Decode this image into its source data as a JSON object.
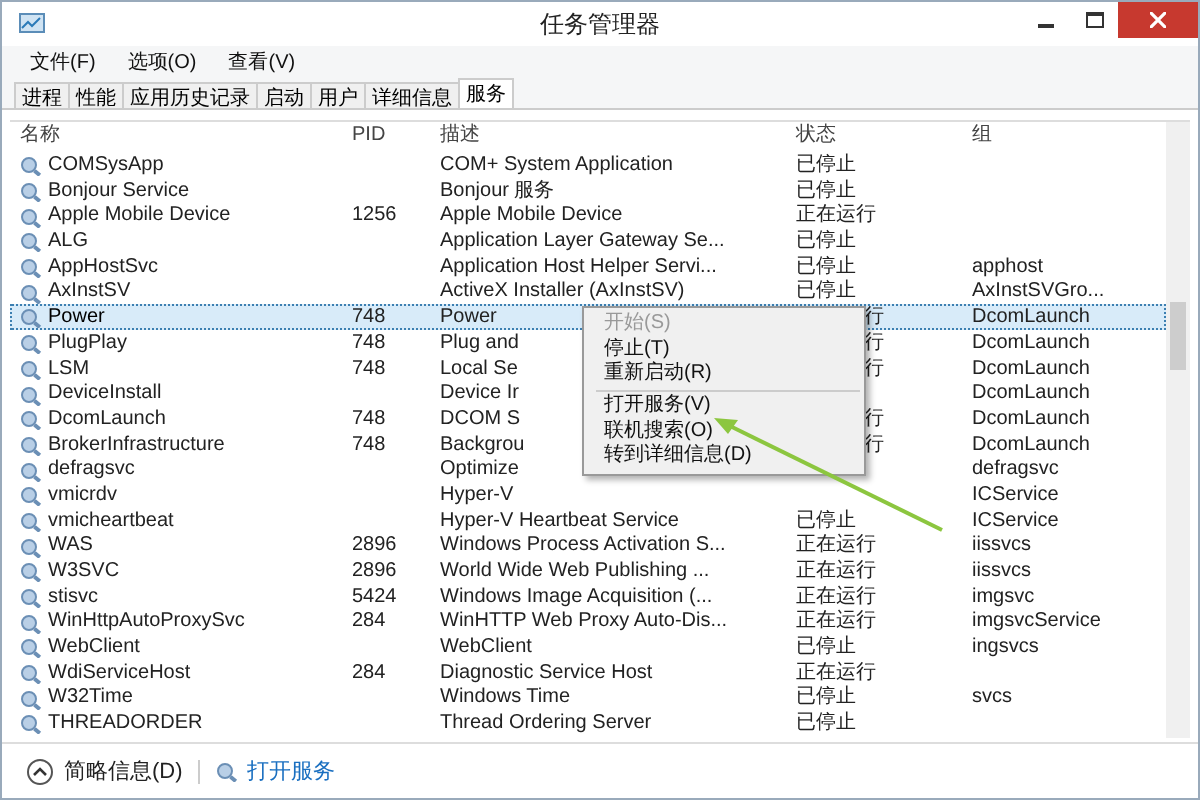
{
  "window": {
    "title": "任务管理器"
  },
  "menu_bar": [
    "文件(F)",
    "选项(O)",
    "查看(V)"
  ],
  "tabs": [
    {
      "label": "进程",
      "selected": false
    },
    {
      "label": "性能",
      "selected": false
    },
    {
      "label": "应用历史记录",
      "selected": false
    },
    {
      "label": "启动",
      "selected": false
    },
    {
      "label": "用户",
      "selected": false
    },
    {
      "label": "详细信息",
      "selected": false
    },
    {
      "label": "服务",
      "selected": true
    }
  ],
  "table": {
    "columns": [
      "名称",
      "PID",
      "描述",
      "状态",
      "组"
    ],
    "rows": [
      {
        "name": "COMSysApp",
        "description": "COM+ System Application",
        "status": "已停止",
        "selected": false
      },
      {
        "name": "Bonjour Service",
        "description": "Bonjour 服务",
        "status": "已停止",
        "selected": false
      },
      {
        "name": "Apple Mobile Device",
        "pid": "1256",
        "description": "Apple Mobile Device",
        "status": "正在运行",
        "selected": false
      },
      {
        "name": "ALG",
        "description": "Application Layer Gateway Se...",
        "status": "已停止",
        "selected": false
      },
      {
        "name": "AppHostSvc",
        "description": "Application Host Helper Servi...",
        "status": "已停止",
        "group": "apphost",
        "selected": false
      },
      {
        "name": "AxInstSV",
        "description": "ActiveX Installer (AxInstSV)",
        "status": "已停止",
        "group": "AxInstSVGro...",
        "selected": false
      },
      {
        "name": "Power",
        "pid": "748",
        "description": "Power",
        "status": "行",
        "group": "DcomLaunch",
        "selected": true,
        "menu_over": true
      },
      {
        "name": "PlugPlay",
        "pid": "748",
        "description": "Plug and",
        "status": "行",
        "group": "DcomLaunch",
        "selected": false,
        "menu_over": true
      },
      {
        "name": "LSM",
        "pid": "748",
        "description": "Local Se",
        "status": "行",
        "group": "DcomLaunch",
        "selected": false,
        "menu_over": true
      },
      {
        "name": "DeviceInstall",
        "description": "Device Ir",
        "group": "DcomLaunch",
        "selected": false
      },
      {
        "name": "DcomLaunch",
        "pid": "748",
        "description": "DCOM S",
        "status": "行",
        "group": "DcomLaunch",
        "selected": false,
        "menu_over": true
      },
      {
        "name": "BrokerInfrastructure",
        "pid": "748",
        "description": "Backgrou",
        "status": "行",
        "group": "DcomLaunch",
        "selected": false,
        "menu_over": true
      },
      {
        "name": "defragsvc",
        "description": "Optimize",
        "group": "defragsvc",
        "selected": false
      },
      {
        "name": "vmicrdv",
        "description": "Hyper-V",
        "group": "ICService",
        "selected": false
      },
      {
        "name": "vmicheartbeat",
        "description": "Hyper-V Heartbeat Service",
        "status": "已停止",
        "group": "ICService",
        "selected": false
      },
      {
        "name": "WAS",
        "pid": "2896",
        "description": "Windows Process Activation S...",
        "status": "正在运行",
        "group": "iissvcs",
        "selected": false
      },
      {
        "name": "W3SVC",
        "pid": "2896",
        "description": "World Wide Web Publishing ...",
        "status": "正在运行",
        "group": "iissvcs",
        "selected": false
      },
      {
        "name": "stisvc",
        "pid": "5424",
        "description": "Windows Image Acquisition (...",
        "status": "正在运行",
        "group": "imgsvc",
        "selected": false
      },
      {
        "name": "WinHttpAutoProxySvc",
        "pid": "284",
        "description": "WinHTTP Web Proxy Auto-Dis...",
        "status": "正在运行",
        "group": "imgsvcService",
        "selected": false
      },
      {
        "name": "WebClient",
        "description": "WebClient",
        "status": "已停止",
        "group": "ingsvcs",
        "selected": false
      },
      {
        "name": "WdiServiceHost",
        "pid": "284",
        "description": "Diagnostic Service Host",
        "status": "正在运行",
        "selected": false
      },
      {
        "name": "W32Time",
        "description": "Windows Time",
        "status": "已停止",
        "group": "svcs",
        "selected": false
      },
      {
        "name": "THREADORDER",
        "description": "Thread Ordering Server",
        "status": "已停止",
        "selected": false
      }
    ]
  },
  "context_menu": [
    {
      "label": "开始(S)",
      "disabled": true,
      "separator_before": false
    },
    {
      "label": "停止(T)",
      "disabled": false,
      "separator_before": false
    },
    {
      "label": "重新启动(R)",
      "disabled": false,
      "separator_before": false
    },
    {
      "label": "打开服务(V)",
      "disabled": false,
      "separator_before": true
    },
    {
      "label": "联机搜索(O)",
      "disabled": false,
      "separator_before": false
    },
    {
      "label": "转到详细信息(D)",
      "disabled": false,
      "separator_before": false
    }
  ],
  "footer": {
    "details_toggle": "简略信息(D)",
    "open_services_link": "打开服务"
  }
}
